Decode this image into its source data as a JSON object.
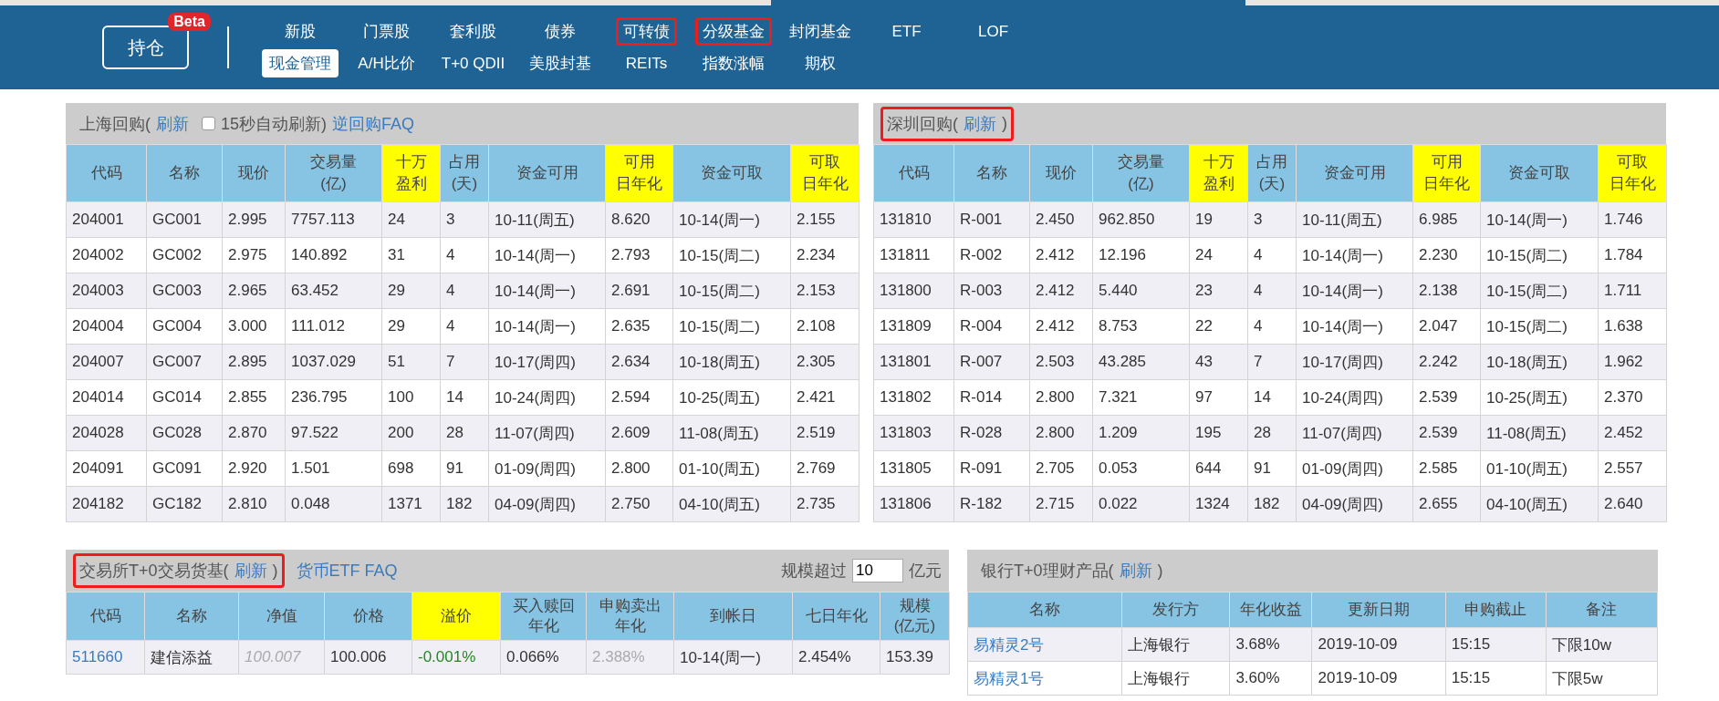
{
  "top_nav": {
    "logo": "持仓",
    "badge": "Beta",
    "rows": [
      [
        {
          "label": "新股",
          "selected": false,
          "annotated": false
        },
        {
          "label": "门票股",
          "selected": false,
          "annotated": false
        },
        {
          "label": "套利股",
          "selected": false,
          "annotated": false
        },
        {
          "label": "债券",
          "selected": false,
          "annotated": false
        },
        {
          "label": "可转债",
          "selected": false,
          "annotated": true
        },
        {
          "label": "分级基金",
          "selected": false,
          "annotated": true
        },
        {
          "label": "封闭基金",
          "selected": false,
          "annotated": false
        },
        {
          "label": "ETF",
          "selected": false,
          "annotated": false
        },
        {
          "label": "LOF",
          "selected": false,
          "annotated": false
        }
      ],
      [
        {
          "label": "现金管理",
          "selected": true,
          "annotated": false
        },
        {
          "label": "A/H比价",
          "selected": false,
          "annotated": false
        },
        {
          "label": "T+0 QDII",
          "selected": false,
          "annotated": false
        },
        {
          "label": "美股封基",
          "selected": false,
          "annotated": false
        },
        {
          "label": "REITs",
          "selected": false,
          "annotated": false
        },
        {
          "label": "指数涨幅",
          "selected": false,
          "annotated": false
        },
        {
          "label": "期权",
          "selected": false,
          "annotated": false
        }
      ]
    ]
  },
  "panels": [
    {
      "header": {
        "groups": [
          {
            "annotated": false,
            "parts": [
              {
                "kind": "text",
                "text": "上海回购("
              },
              {
                "kind": "link",
                "text": "刷新"
              },
              {
                "kind": "checkbox",
                "checked": false
              },
              {
                "kind": "text",
                "text": "15秒自动刷新)"
              },
              {
                "kind": "link",
                "text": "逆回购FAQ"
              }
            ]
          }
        ]
      },
      "table": {
        "columns": [
          {
            "lines": [
              "代码"
            ],
            "highlight": false,
            "kind": "plain"
          },
          {
            "lines": [
              "名称"
            ],
            "highlight": false,
            "kind": "plain"
          },
          {
            "lines": [
              "现价"
            ],
            "highlight": false,
            "kind": "plain"
          },
          {
            "lines": [
              "交易量",
              "(亿)"
            ],
            "highlight": false,
            "kind": "plain"
          },
          {
            "lines": [
              "十万",
              "盈利"
            ],
            "highlight": true,
            "kind": "plain"
          },
          {
            "lines": [
              "占用",
              "(天)"
            ],
            "highlight": false,
            "kind": "plain"
          },
          {
            "lines": [
              "资金可用"
            ],
            "highlight": false,
            "kind": "plain"
          },
          {
            "lines": [
              "可用",
              "日年化"
            ],
            "highlight": true,
            "kind": "plain"
          },
          {
            "lines": [
              "资金可取"
            ],
            "highlight": false,
            "kind": "plain"
          },
          {
            "lines": [
              "可取",
              "日年化"
            ],
            "highlight": true,
            "kind": "plain"
          }
        ],
        "rows": [
          [
            "204001",
            "GC001",
            "2.995",
            "7757.113",
            "24",
            "3",
            "10-11(周五)",
            "8.620",
            "10-14(周一)",
            "2.155"
          ],
          [
            "204002",
            "GC002",
            "2.975",
            "140.892",
            "31",
            "4",
            "10-14(周一)",
            "2.793",
            "10-15(周二)",
            "2.234"
          ],
          [
            "204003",
            "GC003",
            "2.965",
            "63.452",
            "29",
            "4",
            "10-14(周一)",
            "2.691",
            "10-15(周二)",
            "2.153"
          ],
          [
            "204004",
            "GC004",
            "3.000",
            "111.012",
            "29",
            "4",
            "10-14(周一)",
            "2.635",
            "10-15(周二)",
            "2.108"
          ],
          [
            "204007",
            "GC007",
            "2.895",
            "1037.029",
            "51",
            "7",
            "10-17(周四)",
            "2.634",
            "10-18(周五)",
            "2.305"
          ],
          [
            "204014",
            "GC014",
            "2.855",
            "236.795",
            "100",
            "14",
            "10-24(周四)",
            "2.594",
            "10-25(周五)",
            "2.421"
          ],
          [
            "204028",
            "GC028",
            "2.870",
            "97.522",
            "200",
            "28",
            "11-07(周四)",
            "2.609",
            "11-08(周五)",
            "2.519"
          ],
          [
            "204091",
            "GC091",
            "2.920",
            "1.501",
            "698",
            "91",
            "01-09(周四)",
            "2.800",
            "01-10(周五)",
            "2.769"
          ],
          [
            "204182",
            "GC182",
            "2.810",
            "0.048",
            "1371",
            "182",
            "04-09(周四)",
            "2.750",
            "04-10(周五)",
            "2.735"
          ]
        ]
      }
    },
    {
      "header": {
        "groups": [
          {
            "annotated": true,
            "parts": [
              {
                "kind": "text",
                "text": "深圳回购("
              },
              {
                "kind": "link",
                "text": "刷新"
              },
              {
                "kind": "text",
                "text": ")"
              }
            ]
          }
        ]
      },
      "table": {
        "columns": [
          {
            "lines": [
              "代码"
            ],
            "highlight": false,
            "kind": "plain"
          },
          {
            "lines": [
              "名称"
            ],
            "highlight": false,
            "kind": "plain"
          },
          {
            "lines": [
              "现价"
            ],
            "highlight": false,
            "kind": "plain"
          },
          {
            "lines": [
              "交易量",
              "(亿)"
            ],
            "highlight": false,
            "kind": "plain"
          },
          {
            "lines": [
              "十万",
              "盈利"
            ],
            "highlight": true,
            "kind": "plain"
          },
          {
            "lines": [
              "占用",
              "(天)"
            ],
            "highlight": false,
            "kind": "plain"
          },
          {
            "lines": [
              "资金可用"
            ],
            "highlight": false,
            "kind": "plain"
          },
          {
            "lines": [
              "可用",
              "日年化"
            ],
            "highlight": true,
            "kind": "plain"
          },
          {
            "lines": [
              "资金可取"
            ],
            "highlight": false,
            "kind": "plain"
          },
          {
            "lines": [
              "可取",
              "日年化"
            ],
            "highlight": true,
            "kind": "plain"
          }
        ],
        "rows": [
          [
            "131810",
            "R-001",
            "2.450",
            "962.850",
            "19",
            "3",
            "10-11(周五)",
            "6.985",
            "10-14(周一)",
            "1.746"
          ],
          [
            "131811",
            "R-002",
            "2.412",
            "12.196",
            "24",
            "4",
            "10-14(周一)",
            "2.230",
            "10-15(周二)",
            "1.784"
          ],
          [
            "131800",
            "R-003",
            "2.412",
            "5.440",
            "23",
            "4",
            "10-14(周一)",
            "2.138",
            "10-15(周二)",
            "1.711"
          ],
          [
            "131809",
            "R-004",
            "2.412",
            "8.753",
            "22",
            "4",
            "10-14(周一)",
            "2.047",
            "10-15(周二)",
            "1.638"
          ],
          [
            "131801",
            "R-007",
            "2.503",
            "43.285",
            "43",
            "7",
            "10-17(周四)",
            "2.242",
            "10-18(周五)",
            "1.962"
          ],
          [
            "131802",
            "R-014",
            "2.800",
            "7.321",
            "97",
            "14",
            "10-24(周四)",
            "2.539",
            "10-25(周五)",
            "2.370"
          ],
          [
            "131803",
            "R-028",
            "2.800",
            "1.209",
            "195",
            "28",
            "11-07(周四)",
            "2.539",
            "11-08(周五)",
            "2.452"
          ],
          [
            "131805",
            "R-091",
            "2.705",
            "0.053",
            "644",
            "91",
            "01-09(周四)",
            "2.585",
            "01-10(周五)",
            "2.557"
          ],
          [
            "131806",
            "R-182",
            "2.715",
            "0.022",
            "1324",
            "182",
            "04-09(周四)",
            "2.655",
            "04-10(周五)",
            "2.640"
          ]
        ]
      }
    },
    {
      "header": {
        "groups": [
          {
            "annotated": true,
            "parts": [
              {
                "kind": "text",
                "text": "交易所T+0交易货基("
              },
              {
                "kind": "link",
                "text": "刷新"
              },
              {
                "kind": "text",
                "text": ")"
              }
            ]
          },
          {
            "annotated": false,
            "parts": [
              {
                "kind": "link",
                "text": "货币ETF FAQ"
              }
            ]
          }
        ],
        "right": [
          {
            "kind": "text",
            "text": "规模超过"
          },
          {
            "kind": "input",
            "value": "10"
          },
          {
            "kind": "text",
            "text": "亿元"
          }
        ]
      },
      "table": {
        "columns": [
          {
            "lines": [
              "代码"
            ],
            "highlight": false,
            "kind": "link"
          },
          {
            "lines": [
              "名称"
            ],
            "highlight": false,
            "kind": "plain"
          },
          {
            "lines": [
              "净值"
            ],
            "highlight": false,
            "kind": "italic_muted"
          },
          {
            "lines": [
              "价格"
            ],
            "highlight": false,
            "kind": "plain"
          },
          {
            "lines": [
              "溢价"
            ],
            "highlight": true,
            "kind": "down"
          },
          {
            "lines": [
              "买入赎回",
              "年化"
            ],
            "highlight": false,
            "kind": "plain"
          },
          {
            "lines": [
              "申购卖出",
              "年化"
            ],
            "highlight": false,
            "kind": "muted"
          },
          {
            "lines": [
              "到帐日"
            ],
            "highlight": false,
            "kind": "plain"
          },
          {
            "lines": [
              "七日年化"
            ],
            "highlight": false,
            "kind": "plain"
          },
          {
            "lines": [
              "规模",
              "(亿元)"
            ],
            "highlight": false,
            "kind": "plain"
          }
        ],
        "rows": [
          [
            "511660",
            "建信添益",
            "100.007",
            "100.006",
            "-0.001%",
            "0.066%",
            "2.388%",
            "10-14(周一)",
            "2.454%",
            "153.39"
          ]
        ]
      }
    },
    {
      "header": {
        "groups": [
          {
            "annotated": false,
            "parts": [
              {
                "kind": "text",
                "text": "银行T+0理财产品("
              },
              {
                "kind": "link",
                "text": "刷新"
              },
              {
                "kind": "text",
                "text": ")"
              }
            ]
          }
        ]
      },
      "table": {
        "columns": [
          {
            "lines": [
              "名称"
            ],
            "highlight": false,
            "kind": "link"
          },
          {
            "lines": [
              "发行方"
            ],
            "highlight": false,
            "kind": "plain"
          },
          {
            "lines": [
              "年化收益"
            ],
            "highlight": false,
            "kind": "plain"
          },
          {
            "lines": [
              "更新日期"
            ],
            "highlight": false,
            "kind": "plain"
          },
          {
            "lines": [
              "申购截止"
            ],
            "highlight": false,
            "kind": "plain"
          },
          {
            "lines": [
              "备注"
            ],
            "highlight": false,
            "kind": "plain"
          }
        ],
        "rows": [
          [
            "易精灵2号",
            "上海银行",
            "3.68%",
            "2019-10-09",
            "15:15",
            "下限10w"
          ],
          [
            "易精灵1号",
            "上海银行",
            "3.60%",
            "2019-10-09",
            "15:15",
            "下限5w"
          ]
        ]
      }
    }
  ]
}
